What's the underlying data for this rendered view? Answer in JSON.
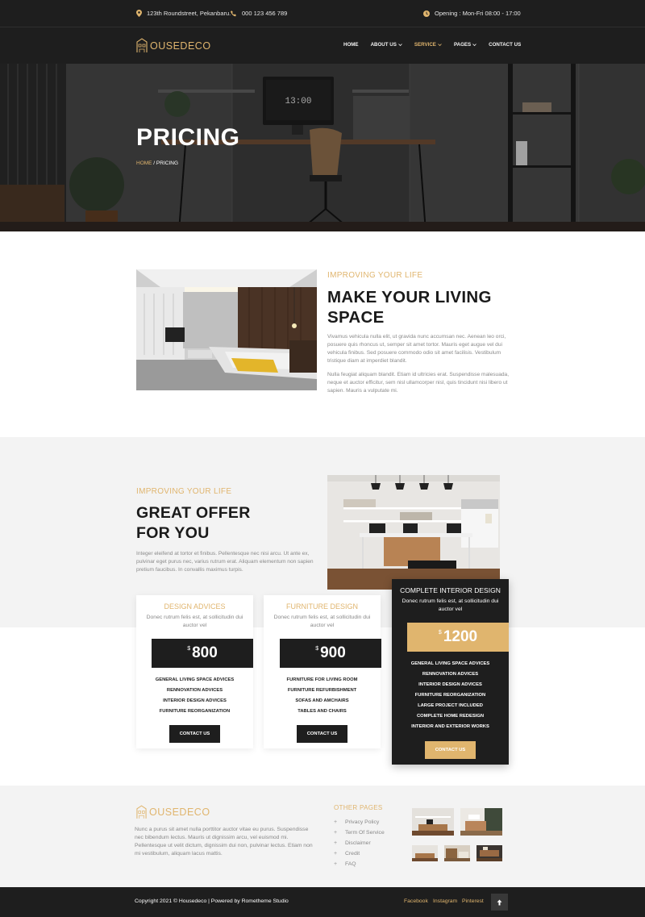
{
  "topbar": {
    "address": "123th Roundstreet, Pekanbaru.",
    "phone": "000 123 456 789",
    "opening": "Opening : Mon-Fri 08:00 - 17:00"
  },
  "brand": {
    "logo_text": "OUSEDECO",
    "accent": "#e0b56e"
  },
  "nav": [
    {
      "label": "HOME"
    },
    {
      "label": "ABOUT US"
    },
    {
      "label": "SERVICE"
    },
    {
      "label": "PAGES"
    },
    {
      "label": "CONTACT US"
    }
  ],
  "hero": {
    "title": "PRICING",
    "crumb_home": "HOME",
    "crumb_sep": " / ",
    "crumb_current": "PRICING",
    "clock": "13:00"
  },
  "about": {
    "eyebrow": "IMPROVING YOUR LIFE",
    "title_line1": "MAKE YOUR LIVING",
    "title_line2": "SPACE",
    "para1": "Vivamus vehicula nulla elit, ut gravida nunc accumsan nec. Aenean leo orci, posuere quis rhoncus ut, semper sit amet tortor. Mauris eget augue vel dui vehicula finibus. Sed posuere commodo odio sit amet facilisis. Vestibulum tristique diam at imperdiet blandit.",
    "para2": "Nulla feugiat aliquam blandit. Etiam id ultricies erat. Suspendisse malesuada, neque et auctor efficitur, sem nisl ullamcorper nisl, quis tincidunt nisi libero ut sapien. Mauris a vulputate mi."
  },
  "offer": {
    "eyebrow": "IMPROVING YOUR LIFE",
    "title_line1": "GREAT OFFER",
    "title_line2": "FOR YOU",
    "para": "Integer eleifend at tortor et finibus. Pellentesque nec nisi arcu. Ut ante ex, pulvinar eget purus nec, varius rutrum erat. Aliquam elementum non sapien pretium faucibus. In convallis maximus turpis."
  },
  "plans": [
    {
      "title": "DESIGN ADVICES",
      "desc": "Donec rutrum felis est, at sollicitudin dui auctor vel",
      "currency": "$",
      "price": "800",
      "features": [
        "GENERAL LIVING SPACE ADVICES",
        "RENNOVATION ADVICES",
        "INTERIOR DESIGN ADVICES",
        "FURNITURE REORGANIZATION"
      ],
      "button": "CONTACT US"
    },
    {
      "title": "FURNITURE DESIGN",
      "desc": "Donec rutrum felis est, at sollicitudin dui auctor vel",
      "currency": "$",
      "price": "900",
      "features": [
        "FURNITURE FOR LIVING ROOM",
        "FURNITURE REFURBISHMENT",
        "SOFAS AND AMCHAIRS",
        "TABLES AND CHAIRS"
      ],
      "button": "CONTACT US"
    },
    {
      "title": "COMPLETE INTERIOR DESIGN",
      "desc": "Donec rutrum felis est, at sollicitudin dui auctor vel",
      "currency": "$",
      "price": "1200",
      "features": [
        "GENERAL LIVING SPACE ADVICES",
        "RENNOVATION ADVICES",
        "INTERIOR DESIGN ADVICES",
        "FURNITURE REORGANIZATION",
        "LARGE PROJECT INCLUDED",
        "COMPLETE HOME REDESIGN",
        "INTERIOR AND EXTERIOR WORKS"
      ],
      "button": "CONTACT US"
    }
  ],
  "footer": {
    "about": "Nunc a purus sit amet nulla porttitor auctor vitae eu purus. Suspendisse nec bibendum lectus. Mauris ut dignissim arcu, vel euismod mi. Pellentesque ut velit dictum, dignissim dui non, pulvinar lectus. Etiam non mi vestibulum, aliquam lacus mattis.",
    "links_title": "OTHER PAGES",
    "links": [
      "Privacy Policy",
      "Term Of Service",
      "Disclaimer",
      "Credit",
      "FAQ"
    ],
    "copyright": "Copyright 2021 © Housedeco | Powered by Rometheme Studio",
    "social": [
      "Facebook",
      "Instagram",
      "Pinterest"
    ]
  }
}
